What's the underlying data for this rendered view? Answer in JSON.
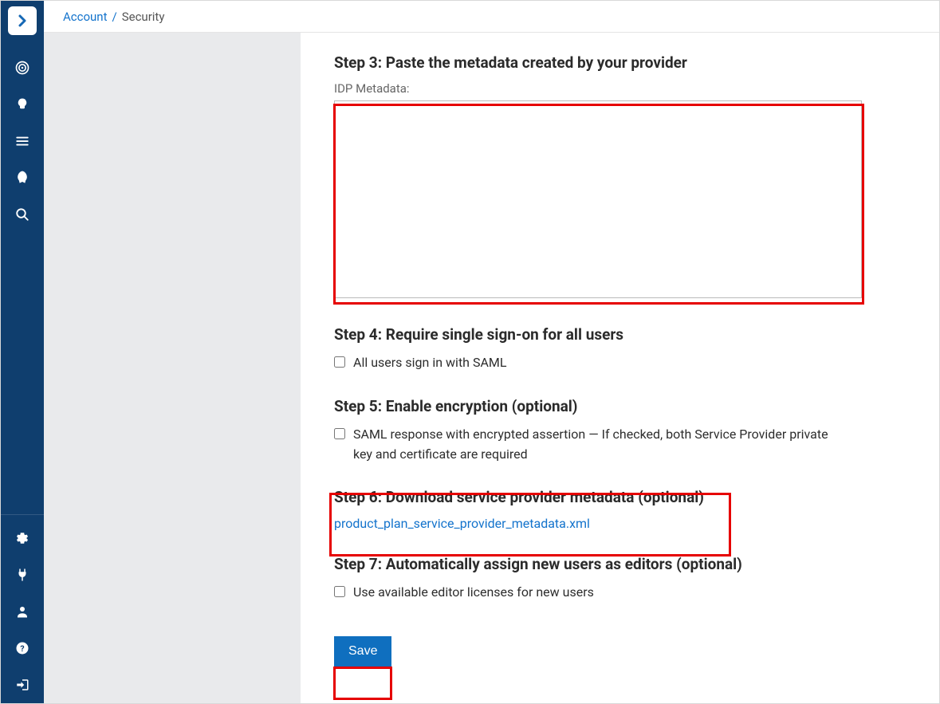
{
  "breadcrumb": {
    "parent": "Account",
    "separator": "/",
    "current": "Security"
  },
  "sidebar": {
    "top_icons": [
      {
        "name": "target-icon"
      },
      {
        "name": "lightbulb-icon"
      },
      {
        "name": "list-icon"
      },
      {
        "name": "rocket-icon"
      },
      {
        "name": "search-icon"
      }
    ],
    "bottom_icons": [
      {
        "name": "gear-icon"
      },
      {
        "name": "plug-icon"
      },
      {
        "name": "user-icon"
      },
      {
        "name": "help-icon"
      },
      {
        "name": "logout-icon"
      }
    ]
  },
  "step3": {
    "title": "Step 3: Paste the metadata created by your provider",
    "field_label": "IDP Metadata:",
    "value": ""
  },
  "step4": {
    "title": "Step 4: Require single sign-on for all users",
    "checkbox_label": "All users sign in with SAML"
  },
  "step5": {
    "title": "Step 5: Enable encryption (optional)",
    "checkbox_label": "SAML response with encrypted assertion — If checked, both Service Provider private key and certificate are required"
  },
  "step6": {
    "title": "Step 6: Download service provider metadata (optional)",
    "link_text": "product_plan_service_provider_metadata.xml"
  },
  "step7": {
    "title": "Step 7: Automatically assign new users as editors (optional)",
    "checkbox_label": "Use available editor licenses for new users"
  },
  "actions": {
    "save_label": "Save"
  }
}
